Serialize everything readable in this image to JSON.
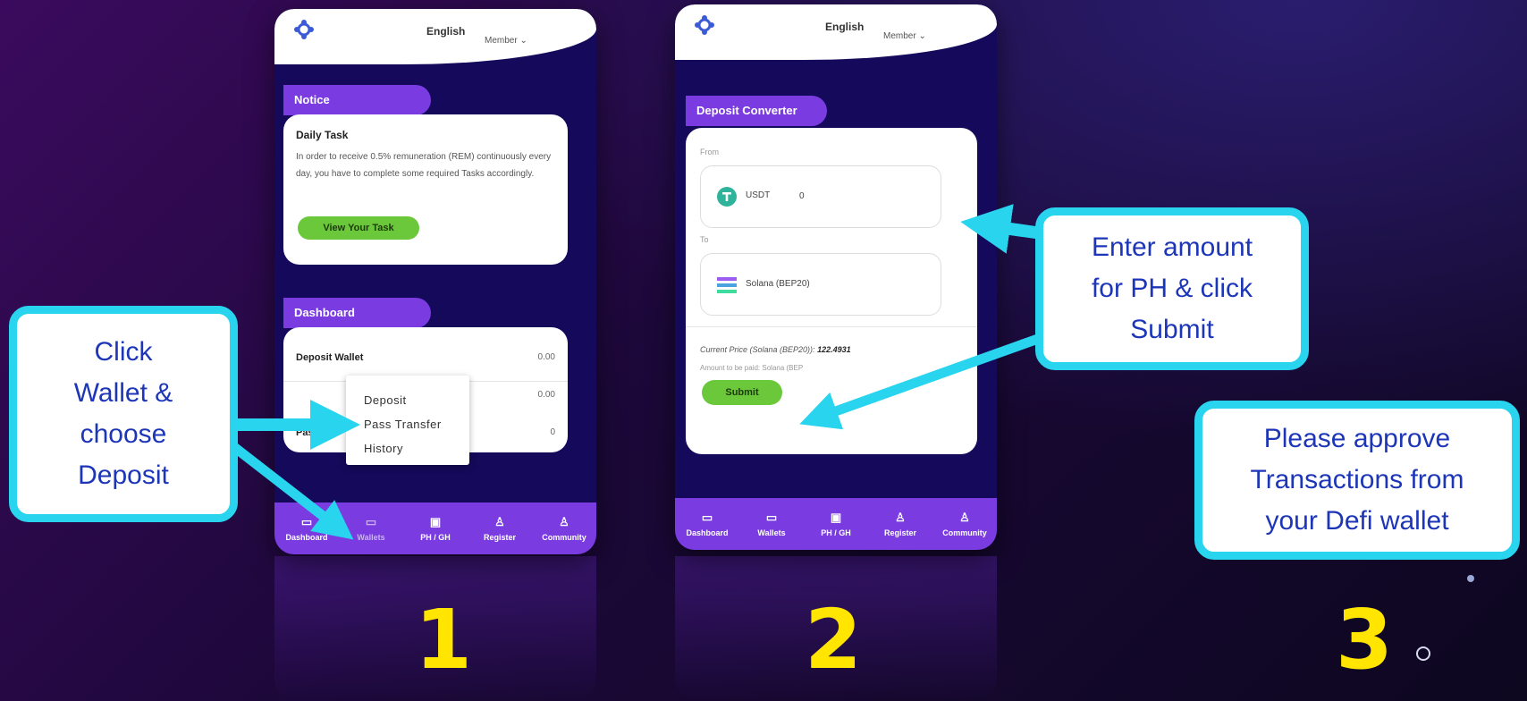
{
  "phone1": {
    "language": "English",
    "member": "Member ⌄",
    "notice_title": "Notice",
    "task_title": "Daily Task",
    "task_text": "In order to receive 0.5% remuneration (REM) continuously every day, you have to complete some required Tasks accordingly.",
    "task_button": "View Your Task",
    "dashboard_title": "Dashboard",
    "rows": [
      {
        "label": "Deposit Wallet",
        "value": "0.00"
      },
      {
        "label": "",
        "value": "0.00"
      },
      {
        "label": "Pass",
        "value": "0"
      }
    ],
    "menu": [
      "Deposit",
      "Pass Transfer",
      "History"
    ],
    "nav": [
      "Dashboard",
      "Wallets",
      "PH / GH",
      "Register",
      "Community"
    ]
  },
  "phone2": {
    "language": "English",
    "member": "Member ⌄",
    "converter_title": "Deposit Converter",
    "from_label": "From",
    "from_currency": "USDT",
    "from_amount": "0",
    "to_label": "To",
    "to_currency": "Solana (BEP20)",
    "price_label": "Current Price (Solana (BEP20)):",
    "price_value": "122.4931",
    "amount_label": "Amount to be paid: Solana (BEP",
    "submit": "Submit",
    "nav": [
      "Dashboard",
      "Wallets",
      "PH / GH",
      "Register",
      "Community"
    ]
  },
  "callouts": {
    "one": [
      "Click",
      "Wallet &",
      "choose",
      "Deposit"
    ],
    "two": [
      "Enter amount",
      "for PH & click",
      "Submit"
    ],
    "three": [
      "Please approve",
      "Transactions from",
      "your Defi wallet"
    ]
  },
  "steps": [
    "1",
    "2",
    "3"
  ],
  "colors": {
    "accent": "#7a3ce0",
    "callout_border": "#29d4ef",
    "step_number": "#ffe500",
    "button_green": "#6cc83b"
  }
}
